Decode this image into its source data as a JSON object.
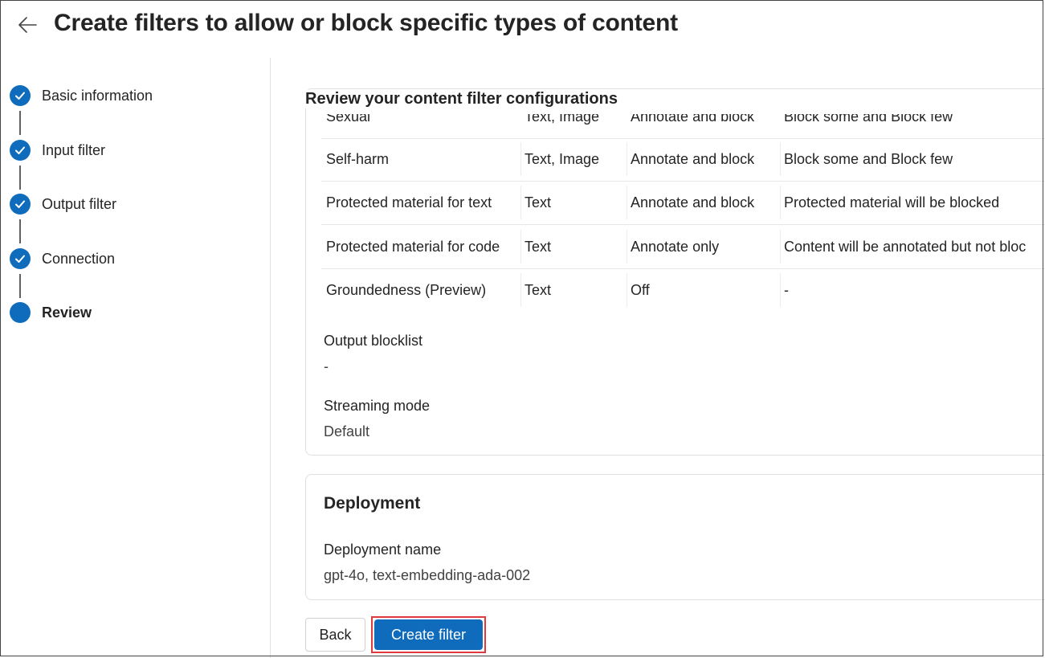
{
  "header": {
    "title": "Create filters to allow or block specific types of content",
    "back_icon": "arrow-left-icon"
  },
  "stepper": {
    "steps": [
      {
        "label": "Basic information",
        "state": "completed"
      },
      {
        "label": "Input filter",
        "state": "completed"
      },
      {
        "label": "Output filter",
        "state": "completed"
      },
      {
        "label": "Connection",
        "state": "completed"
      },
      {
        "label": "Review",
        "state": "current"
      }
    ]
  },
  "review": {
    "title": "Review your content filter configurations",
    "rows": [
      {
        "category": "Sexual",
        "modality": "Text, Image",
        "action": "Annotate and block",
        "threshold": "Block some and Block few"
      },
      {
        "category": "Self-harm",
        "modality": "Text, Image",
        "action": "Annotate and block",
        "threshold": "Block some and Block few"
      },
      {
        "category": "Protected material for text",
        "modality": "Text",
        "action": "Annotate and block",
        "threshold": "Protected material will be blocked"
      },
      {
        "category": "Protected material for code",
        "modality": "Text",
        "action": "Annotate only",
        "threshold": "Content will be annotated but not bloc"
      },
      {
        "category": "Groundedness (Preview)",
        "modality": "Text",
        "action": "Off",
        "threshold": "-"
      }
    ],
    "output_blocklist_label": "Output blocklist",
    "output_blocklist_value": "-",
    "streaming_mode_label": "Streaming mode",
    "streaming_mode_value": "Default"
  },
  "deployment": {
    "title": "Deployment",
    "name_label": "Deployment name",
    "name_value": "gpt-4o, text-embedding-ada-002"
  },
  "actions": {
    "back_label": "Back",
    "create_label": "Create filter"
  },
  "colors": {
    "accent": "#0f6cbd",
    "highlight": "#e0393e"
  }
}
